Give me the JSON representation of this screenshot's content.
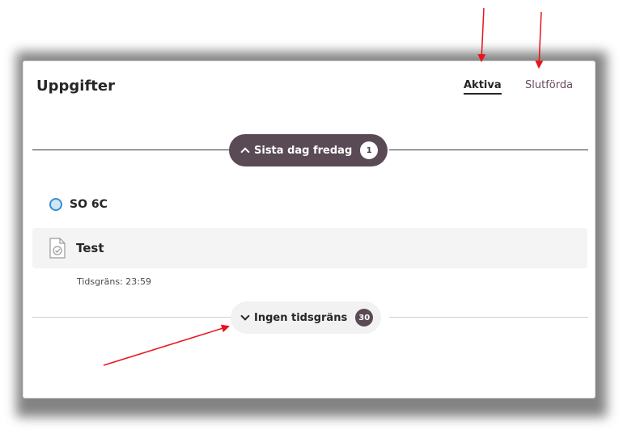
{
  "header": {
    "title": "Uppgifter",
    "tabs": [
      {
        "label": "Aktiva",
        "active": true
      },
      {
        "label": "Slutförda",
        "active": false
      }
    ]
  },
  "groups": [
    {
      "label": "Sista dag fredag",
      "count": "1",
      "expanded": true,
      "courses": [
        {
          "name": "SO 6C",
          "assignments": [
            {
              "name": "Test",
              "deadline": "Tidsgräns: 23:59",
              "icon": "assignment-check-icon"
            }
          ]
        }
      ]
    },
    {
      "label": "Ingen tidsgräns",
      "count": "30",
      "expanded": false
    }
  ],
  "colors": {
    "accent_dark": "#5a4a55",
    "inactive_tab": "#6b4a5e",
    "course_dot": "#3a8fd1",
    "annotation_arrow": "#e8141b"
  }
}
